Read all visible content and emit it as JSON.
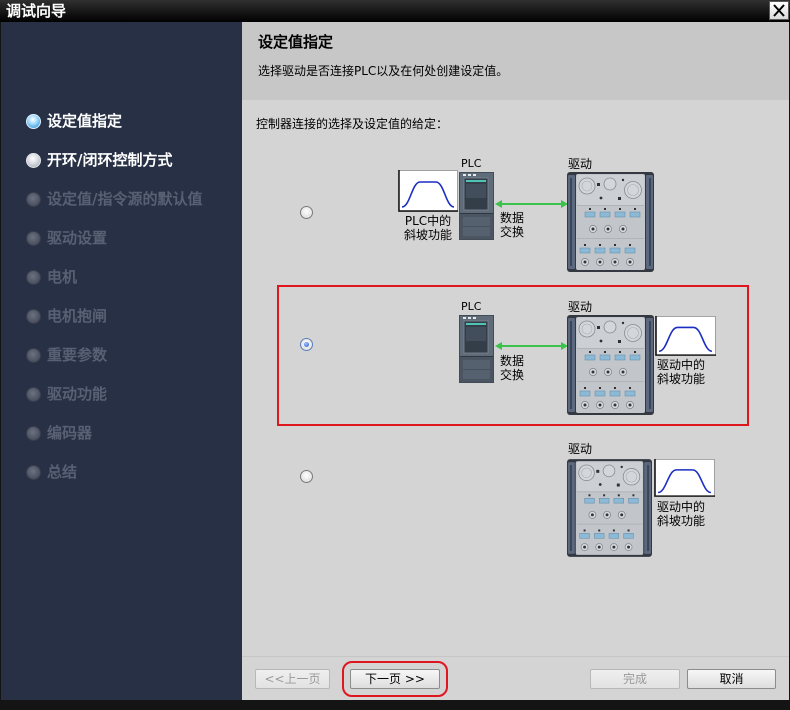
{
  "window": {
    "title": "调试向导",
    "close_icon": "close-icon"
  },
  "colors": {
    "sidebar_bg": "#283046",
    "header_bg": "#c7c7c7",
    "body_bg": "#d4d4d4",
    "highlight": "#e0161e",
    "exchange_arrow": "#3bc24b",
    "ramp_curve": "#1b2ec2"
  },
  "sidebar": {
    "steps": [
      {
        "label": "设定值指定",
        "current": true,
        "enabled": true
      },
      {
        "label": "开环/闭环控制方式",
        "current": false,
        "enabled": true
      },
      {
        "label": "设定值/指令源的默认值",
        "current": false,
        "enabled": false
      },
      {
        "label": "驱动设置",
        "current": false,
        "enabled": false
      },
      {
        "label": "电机",
        "current": false,
        "enabled": false
      },
      {
        "label": "电机抱闸",
        "current": false,
        "enabled": false
      },
      {
        "label": "重要参数",
        "current": false,
        "enabled": false
      },
      {
        "label": "驱动功能",
        "current": false,
        "enabled": false
      },
      {
        "label": "编码器",
        "current": false,
        "enabled": false
      },
      {
        "label": "总结",
        "current": false,
        "enabled": false
      }
    ]
  },
  "header": {
    "title": "设定值指定",
    "subtitle": "选择驱动是否连接PLC以及在何处创建设定值。"
  },
  "main": {
    "prompt": "控制器连接的选择及设定值的给定：",
    "options": [
      {
        "selected": false,
        "highlighted": false,
        "plc_label": "PLC",
        "exchange_label": [
          "数据",
          "交换"
        ],
        "drive_label": "驱动",
        "ramp_label": [
          "PLC中的",
          "斜坡功能"
        ]
      },
      {
        "selected": true,
        "highlighted": true,
        "plc_label": "PLC",
        "exchange_label": [
          "数据",
          "交换"
        ],
        "drive_label": "驱动",
        "ramp_label": [
          "驱动中的",
          "斜坡功能"
        ]
      },
      {
        "selected": false,
        "highlighted": false,
        "drive_label": "驱动",
        "ramp_label": [
          "驱动中的",
          "斜坡功能"
        ]
      }
    ]
  },
  "footer": {
    "prev": {
      "label": "<<上一页",
      "enabled": false
    },
    "next": {
      "label": "下一页 >>",
      "enabled": true,
      "highlighted": true
    },
    "finish": {
      "label": "完成",
      "enabled": false
    },
    "cancel": {
      "label": "取消",
      "enabled": true
    }
  }
}
